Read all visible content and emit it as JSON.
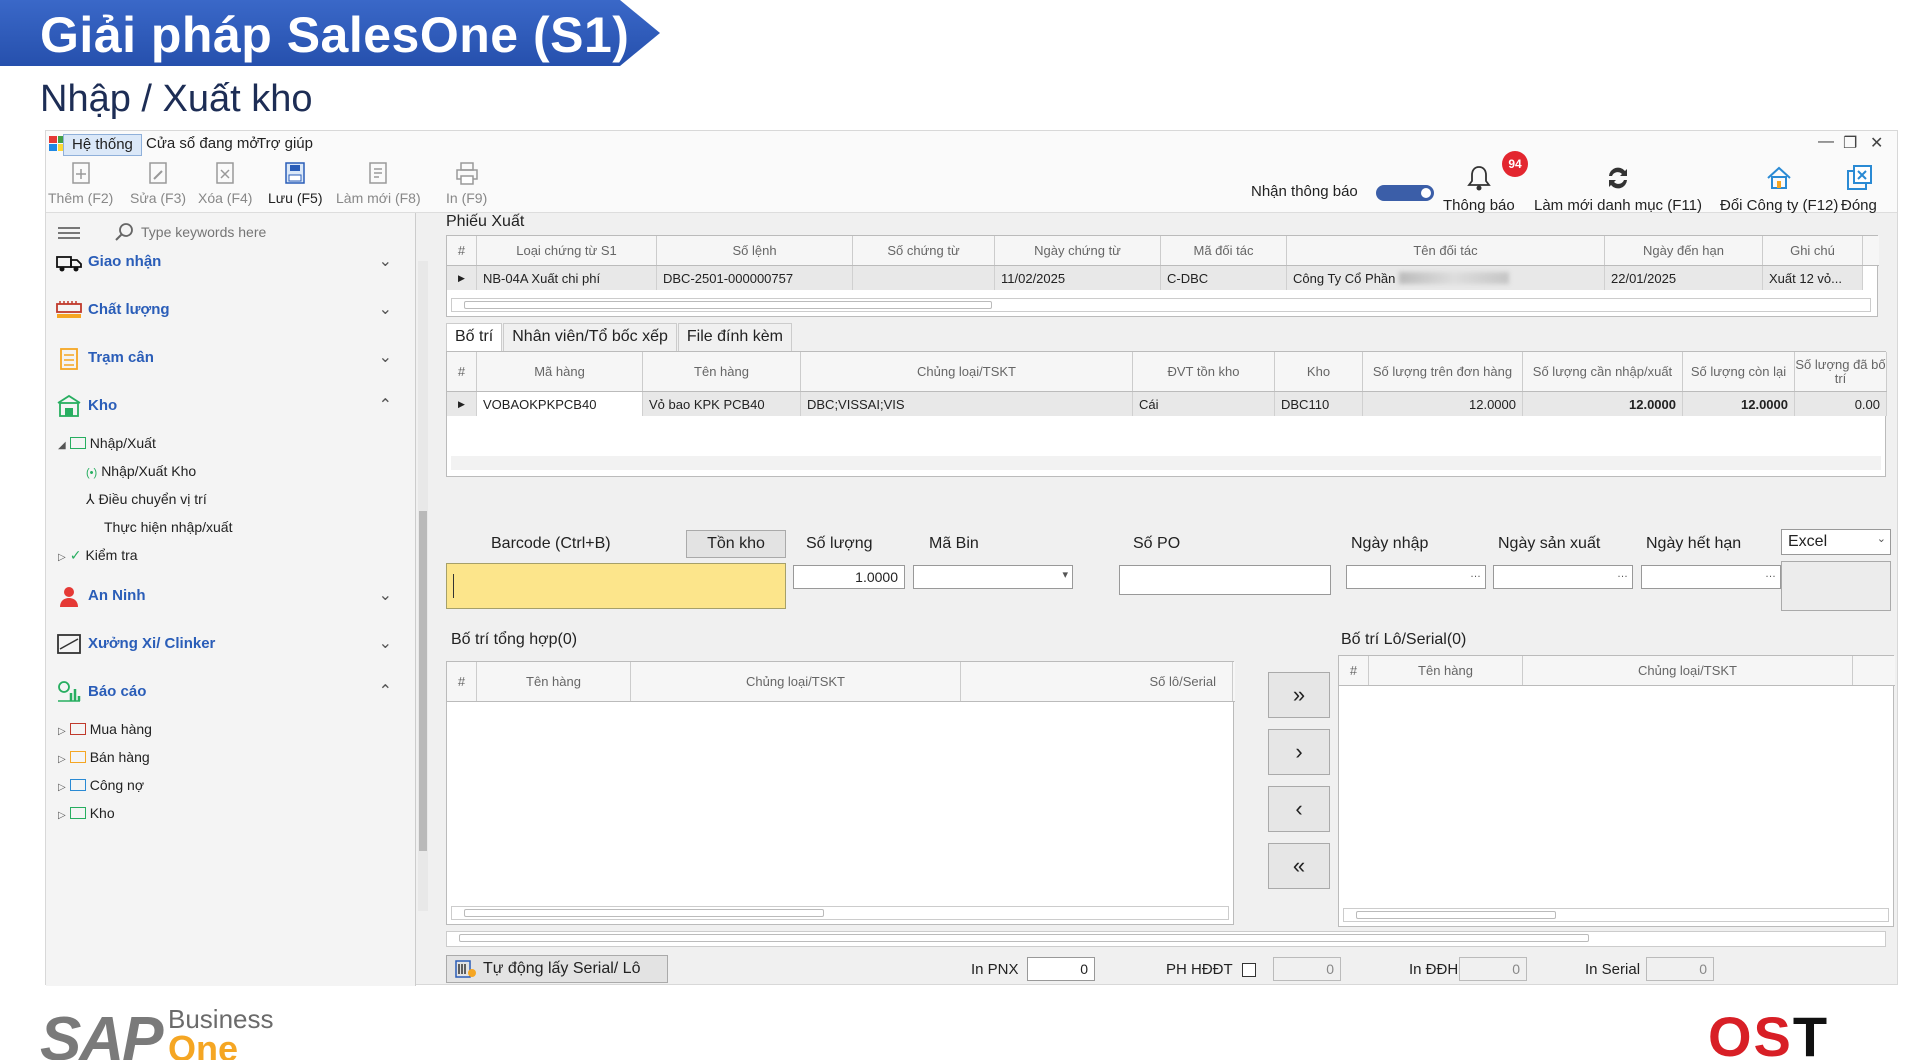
{
  "slide": {
    "banner_title": "Giải pháp SalesOne (S1)",
    "subtitle": "Nhập / Xuất kho"
  },
  "menu": {
    "items": [
      "Hệ thống",
      "Cửa sổ đang mở",
      "Trợ giúp"
    ]
  },
  "toolbar": {
    "buttons": [
      {
        "label": "Thêm (F2)",
        "icon": "add-doc-icon"
      },
      {
        "label": "Sửa (F3)",
        "icon": "edit-doc-icon"
      },
      {
        "label": "Xóa (F4)",
        "icon": "delete-doc-icon"
      },
      {
        "label": "Lưu (F5)",
        "icon": "save-icon"
      },
      {
        "label": "Làm mới (F8)",
        "icon": "refresh-doc-icon"
      },
      {
        "label": "In (F9)",
        "icon": "printer-icon"
      }
    ],
    "notify_label": "Nhận thông báo",
    "badge_count": "94",
    "right": [
      {
        "label": "Thông báo",
        "icon": "bell-icon"
      },
      {
        "label": "Làm mới danh mục (F11)",
        "icon": "refresh-icon"
      },
      {
        "label": "Đổi Công ty (F12)",
        "icon": "home-icon"
      },
      {
        "label": "Đóng",
        "icon": "close-window-icon"
      }
    ]
  },
  "sidebar": {
    "search_placeholder": "Type keywords here",
    "groups": [
      {
        "label": "Giao nhận",
        "icon": "truck-icon"
      },
      {
        "label": "Chất lượng",
        "icon": "quality-icon"
      },
      {
        "label": "Trạm cân",
        "icon": "scale-icon"
      },
      {
        "label": "Kho",
        "icon": "warehouse-icon"
      },
      {
        "label": "An Ninh",
        "icon": "security-guard-icon"
      },
      {
        "label": "Xưởng Xi/ Clinker",
        "icon": "factory-icon"
      },
      {
        "label": "Báo cáo",
        "icon": "report-icon"
      }
    ],
    "kho_items": [
      "Nhập/Xuất",
      "Nhập/Xuất Kho",
      "Điều chuyển vị trí",
      "Thực hiện nhập/xuất",
      "Kiểm tra"
    ],
    "bao_cao_items": [
      "Mua hàng",
      "Bán hàng",
      "Công nợ",
      "Kho"
    ]
  },
  "phieu_xuat": {
    "title": "Phiếu Xuất",
    "headers": [
      "#",
      "Loại chứng từ S1",
      "Số lệnh",
      "Số chứng từ",
      "Ngày chứng từ",
      "Mã đối tác",
      "Tên đối tác",
      "Ngày đến hạn",
      "Ghi chú"
    ],
    "row": [
      "NB-04A Xuất chi phí",
      "DBC-2501-000000757",
      "",
      "11/02/2025",
      "C-DBC",
      "Công Ty Cổ Phần",
      "22/01/2025",
      "Xuất 12 vỏ..."
    ]
  },
  "tabs": [
    "Bố trí",
    "Nhân viên/Tổ bốc xếp",
    "File đính kèm"
  ],
  "bo_tri": {
    "headers": [
      "#",
      "Mã hàng",
      "Tên hàng",
      "Chủng loại/TSKT",
      "ĐVT tồn kho",
      "Kho",
      "Số lượng trên đơn hàng",
      "Số lượng cần nhập/xuất",
      "Số lượng còn lại",
      "Số lượng đã bố trí"
    ],
    "row": [
      "VOBAOKPKPCB40",
      "Vỏ bao KPK PCB40",
      "DBC;VISSAI;VIS",
      "Cái",
      "DBC110",
      "12.0000",
      "12.0000",
      "12.0000",
      "0.00"
    ]
  },
  "form": {
    "barcode_label": "Barcode (Ctrl+B)",
    "ton_kho_button": "Tồn kho",
    "so_luong_label": "Số lượng",
    "so_luong_value": "1.0000",
    "ma_bin_label": "Mã Bin",
    "so_po_label": "Số PO",
    "ngay_nhap_label": "Ngày nhập",
    "ngay_san_xuat_label": "Ngày sản xuất",
    "ngay_het_han_label": "Ngày hết hạn",
    "export_option": "Excel"
  },
  "tong_hop": {
    "title": "Bố trí tổng hợp(0)",
    "headers": [
      "#",
      "Tên hàng",
      "Chủng loại/TSKT",
      "Số lô/Serial"
    ]
  },
  "lo_serial": {
    "title": "Bố trí Lô/Serial(0)",
    "headers": [
      "#",
      "Tên hàng",
      "Chủng loại/TSKT"
    ]
  },
  "footer": {
    "auto_serial_button": "Tự động lấy Serial/ Lô",
    "in_pnx_label": "In PNX",
    "in_pnx_value": "0",
    "ph_hddt_label": "PH HĐĐT",
    "ph_hddt_value": "0",
    "in_ddh_label": "In ĐĐH",
    "in_ddh_value": "0",
    "in_serial_label": "In Serial",
    "in_serial_value": "0"
  },
  "logos": {
    "sap": "SAP",
    "sap_business": "Business",
    "sap_one": "One",
    "ost_a": "OS",
    "ost_b": "T"
  },
  "colors": {
    "banner": "#2f5ec0",
    "accent": "#2a5db8",
    "barcode_field": "#fce58b",
    "badge": "#e3262f",
    "ost_red": "#d81f26"
  }
}
